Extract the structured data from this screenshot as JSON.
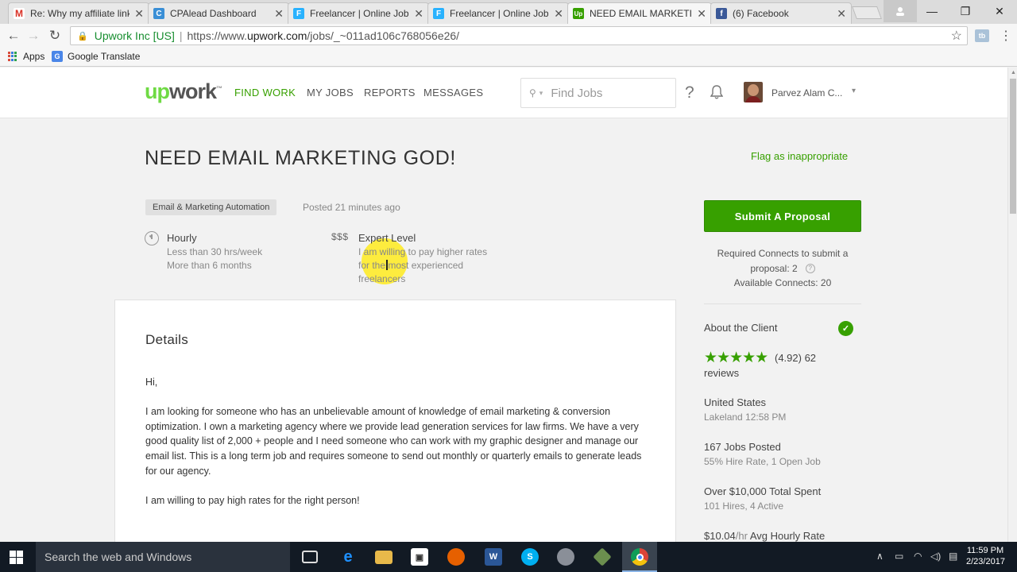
{
  "browser": {
    "tabs": [
      {
        "title": "Re: Why my affiliate link",
        "icon": "gmail-icon",
        "color": "#d93025",
        "glyph": "M",
        "active": false
      },
      {
        "title": "CPAlead Dashboard",
        "icon": "cpalead-icon",
        "color": "#3a8fd6",
        "glyph": "C",
        "active": false
      },
      {
        "title": "Freelancer | Online Jobs",
        "icon": "freelancer-icon",
        "color": "#29b2fe",
        "glyph": "F",
        "active": false
      },
      {
        "title": "Freelancer | Online Jobs",
        "icon": "freelancer-icon",
        "color": "#29b2fe",
        "glyph": "F",
        "active": false
      },
      {
        "title": "NEED EMAIL MARKETING",
        "icon": "upwork-icon",
        "color": "#37a000",
        "glyph": "Up",
        "active": true
      },
      {
        "title": "(6) Facebook",
        "icon": "facebook-icon",
        "color": "#3b5998",
        "glyph": "f",
        "active": false
      }
    ],
    "site_label": "Upwork Inc [US]",
    "url_prefix": "https://www.",
    "url_domain": "upwork.com",
    "url_path": "/jobs/_~011ad106c768056e26/",
    "bookmarks": {
      "apps": "Apps",
      "google_translate": "Google Translate"
    }
  },
  "upwork": {
    "nav": {
      "find_work": "FIND WORK",
      "my_jobs": "MY JOBS",
      "reports": "REPORTS",
      "messages": "MESSAGES"
    },
    "search_placeholder": "Find Jobs",
    "help": "?",
    "user_name": "Parvez Alam C..."
  },
  "job": {
    "title": "NEED EMAIL MARKETING GOD!",
    "flag": "Flag as inappropriate",
    "category": "Email & Marketing Automation",
    "posted": "Posted 21 minutes ago",
    "type_head": "Hourly",
    "type_line1": "Less than 30 hrs/week",
    "type_line2": "More than 6 months",
    "level_symbol": "$$$",
    "level_head": "Expert Level",
    "level_line1": "I am willing to pay higher rates",
    "level_line2": "for the most experienced",
    "level_line3": "freelancers",
    "details_title": "Details",
    "greeting": "Hi,",
    "body": "I am looking for someone who has an unbelievable amount of knowledge of email marketing & conversion optimization. I own a marketing agency where we provide lead generation services for law firms. We have a very good quality list of 2,000 + people and I need someone who can work with my graphic designer and manage our email list. This is a long term job and requires someone to send out monthly or quarterly emails to generate leads for our agency.",
    "closing": "I am willing to pay high rates for the right person!"
  },
  "sidebar": {
    "submit_label": "Submit A Proposal",
    "connects_line1": "Required Connects to submit a",
    "connects_line2": "proposal: 2",
    "connects_line3": "Available Connects: 20",
    "about_title": "About the Client",
    "rating_value": 4.92,
    "rating_text": "(4.92) 62",
    "reviews_text": "reviews",
    "country": "United States",
    "local_time": "Lakeland 12:58 PM",
    "jobs_posted": "167 Jobs Posted",
    "hire_rate": "55% Hire Rate, 1 Open Job",
    "total_spent": "Over $10,000 Total Spent",
    "hires": "101 Hires, 4 Active",
    "avg_rate_value": "$10.04",
    "avg_rate_unit": "/hr",
    "avg_rate_label": "Avg Hourly Rate"
  },
  "taskbar": {
    "search_placeholder": "Search the web and Windows",
    "time": "11:59 PM",
    "date": "2/23/2017"
  },
  "colors": {
    "upwork_green": "#37a000",
    "logo_green": "#6fda44",
    "highlight_yellow": "#ffeb1e"
  }
}
